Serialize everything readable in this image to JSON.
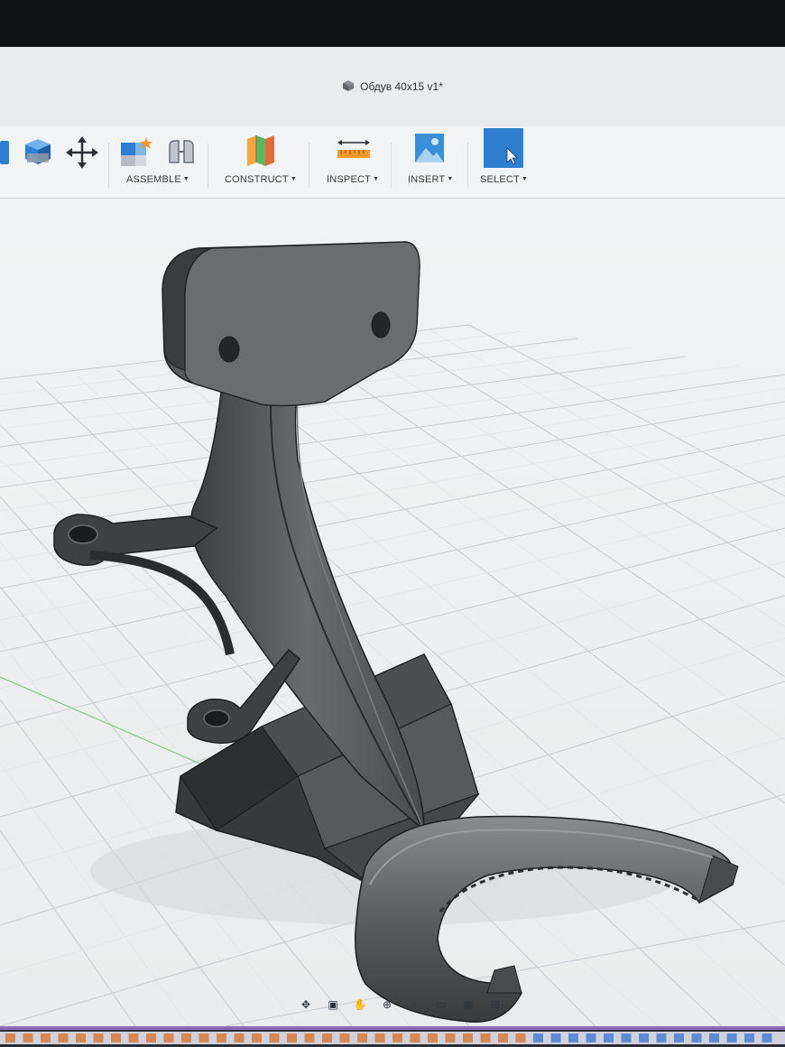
{
  "window": {
    "document_title": "Обдув 40х15 v1*",
    "document_icon": "cube-icon"
  },
  "toolbar": {
    "groups": [
      {
        "label": "ASSEMBLE",
        "icon": "assemble-icon"
      },
      {
        "label": "CONSTRUCT",
        "icon": "construct-plane-icon"
      },
      {
        "label": "INSPECT",
        "icon": "measure-icon"
      },
      {
        "label": "INSERT",
        "icon": "insert-image-icon"
      },
      {
        "label": "SELECT",
        "icon": "select-cursor-icon"
      }
    ],
    "left_tools": [
      "extrude-icon",
      "shell-icon",
      "move-icon"
    ],
    "accent_color": "#2f7fd1"
  },
  "viewport": {
    "model": "fan-duct-bracket",
    "grid": true
  },
  "navbar": {
    "tools": [
      "orbit-icon",
      "look-at-icon",
      "pan-icon",
      "zoom-icon",
      "fit-icon",
      "display-settings-icon",
      "grid-settings-icon",
      "viewports-icon"
    ]
  },
  "timeline": {
    "visible": true
  }
}
